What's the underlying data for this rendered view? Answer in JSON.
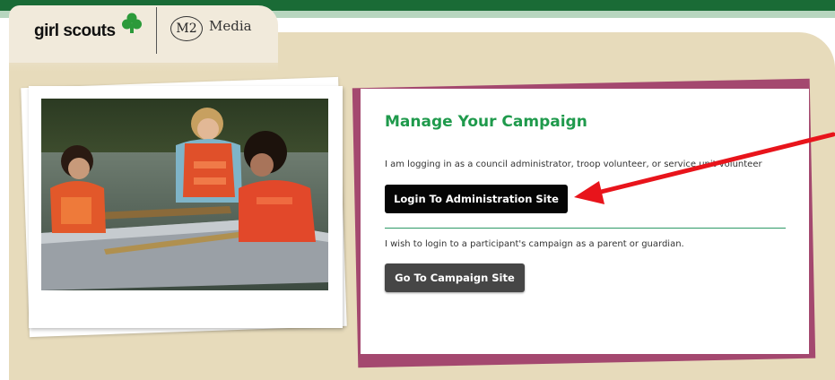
{
  "header": {
    "logo_text": "girl scouts",
    "partner_mark": "M2",
    "partner_name": "Media"
  },
  "photo": {
    "description_icon": "photo-girls-canoe"
  },
  "card": {
    "title": "Manage Your Campaign",
    "admin_prompt": "I am logging in as a council administrator, troop volunteer, or service unit volunteer",
    "admin_button_label": "Login To Administration Site",
    "parent_prompt": "I wish to login to a participant's campaign as a parent or guardian.",
    "campaign_button_label": "Go To Campaign Site"
  },
  "colors": {
    "brand_green": "#1a6b36",
    "title_green": "#1f9a4c",
    "accent_magenta": "#a4486f",
    "background_tan": "#e7dbbb",
    "arrow_red": "#e8141b"
  }
}
